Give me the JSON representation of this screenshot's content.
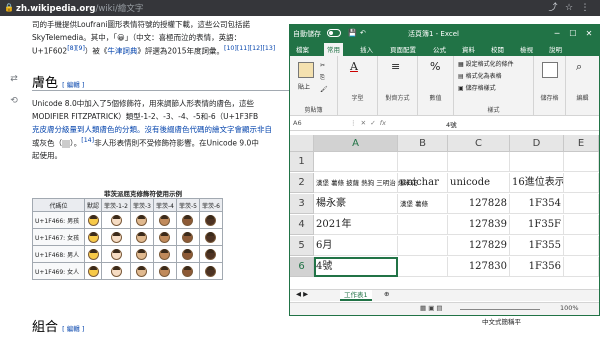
{
  "browser": {
    "url_host": "zh.wikipedia.org",
    "url_path": "/wiki/繪文字"
  },
  "wiki": {
    "para1_line1": "司的手機提供Loufrani圖形表情符號的授權下載，這些公司包括諾",
    "para1_line2": "SkyTelemedia。其中，「😀」（中文：喜極而泣的表情，英語：",
    "para1_line3_prefix": "U+1F602",
    "para1_line3_ref": "[8][9]",
    "para1_line3_mid": "）被《",
    "para1_line3_link": "牛津詞典",
    "para1_line3_suffix": "》評選為2015年度詞彙。",
    "para1_line3_refs2": "[10][11][12][13]",
    "heading_skin": "膚色",
    "edit_label": "[ 編輯 ]",
    "para2_line1": "Unicode 8.0中加入了5個修飾符，用來調節人形表情的膚色，這些",
    "para2_line2": "MODIFIER FITZPATRICK）類型-1-2、-3、-4、-5和-6（U+1F3FB",
    "para2_line3": "克皮膚分級量到人類膚色的分類。沒有後綴膚色代碼的繪文字會顯示非自",
    "para2_line4_a": "或灰色（",
    "para2_line4_b": "）。",
    "para2_line4_ref": "[14]",
    "para2_line4_c": "非人形表情則不受修飾符影響。在Unicode 9.0中",
    "para2_line5": "起使用。",
    "table_caption": "菲茨派屈克修飾符使用示例",
    "table_headers": [
      "代碼位",
      "默認",
      "菲茨-1-2",
      "菲茨-3",
      "菲茨-4",
      "菲茨-5",
      "菲茨-6"
    ],
    "table_rows": [
      {
        "code": "U+1F466: 男孩"
      },
      {
        "code": "U+1F467: 女孩"
      },
      {
        "code": "U+1F468: 男人"
      },
      {
        "code": "U+1F469: 女人"
      }
    ],
    "skin_colors": [
      "#f7c948",
      "#f6dcc3",
      "#e0b98f",
      "#c08a5b",
      "#8d5a36",
      "#4d3222"
    ],
    "heading_combo": "組合",
    "bottom_right_text": "中文式簡稱平"
  },
  "excel": {
    "autosave_label": "自動儲存",
    "title": "活頁簿1 - Excel",
    "tabs": [
      "檔案",
      "常用",
      "插入",
      "頁面配置",
      "公式",
      "資料",
      "校閱",
      "檢視",
      "說明"
    ],
    "active_tab": "常用",
    "ribbon": {
      "paste": "貼上",
      "clipboard": "剪貼簿",
      "font": "字型",
      "alignment": "對齊方式",
      "number": "數值",
      "cond_format": "設定格式化的條件",
      "table_format": "格式化為表格",
      "cell_styles": "儲存格樣式",
      "styles": "樣式",
      "cells": "儲存格",
      "editing": "編輯"
    },
    "name_box": "A6",
    "fx": "fx",
    "formula_value": "4號",
    "columns": [
      "A",
      "B",
      "C",
      "D",
      "E"
    ],
    "rows": [
      "1",
      "2",
      "3",
      "4",
      "5",
      "6"
    ],
    "row2": {
      "emoji_header": "漢堡 薯條 披薩 熱狗 三明治 爆米花",
      "b": "unichar",
      "c": "unicode",
      "d": "16進位表示"
    },
    "data_rows": [
      {
        "a": "楊永豪",
        "b": "漢堡 薯條",
        "c": "127828",
        "d": "1F354"
      },
      {
        "a": "2021年",
        "b": "",
        "c": "127839",
        "d": "1F35F"
      },
      {
        "a": "6月",
        "b": "",
        "c": "127829",
        "d": "1F355"
      },
      {
        "a": "4號",
        "b": "",
        "c": "127830",
        "d": "1F356"
      }
    ],
    "sheet_tab": "工作表1",
    "zoom": "100%"
  }
}
